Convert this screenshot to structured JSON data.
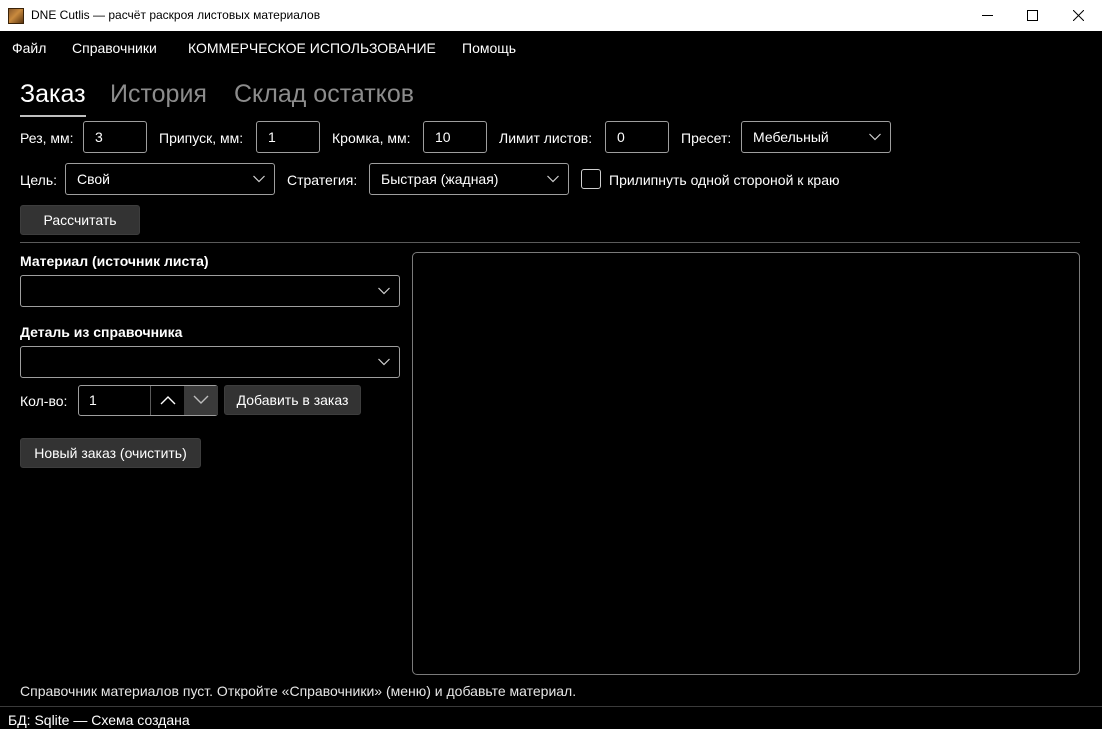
{
  "window": {
    "title": "DNE Cutlis — расчёт раскроя листовых материалов",
    "icon": "app-icon"
  },
  "menu": [
    "Файл",
    "Справочники",
    "КОММЕРЧЕСКОЕ ИСПОЛЬЗОВАНИЕ",
    "Помощь"
  ],
  "tabs": [
    {
      "label": "Заказ",
      "active": true
    },
    {
      "label": "История",
      "active": false
    },
    {
      "label": "Склад остатков",
      "active": false
    }
  ],
  "params": {
    "cut_label": "Рез, мм:",
    "cut_value": "3",
    "allowance_label": "Припуск, мм:",
    "allowance_value": "1",
    "edge_label": "Кромка, мм:",
    "edge_value": "10",
    "sheet_limit_label": "Лимит листов:",
    "sheet_limit_value": "0",
    "preset_label": "Пресет:",
    "preset_value": "Мебельный"
  },
  "goal": {
    "label": "Цель:",
    "value": "Свой"
  },
  "strategy": {
    "label": "Стратегия:",
    "value": "Быстрая (жадная)"
  },
  "stick_edge": {
    "label": "Прилипнуть одной стороной к краю",
    "checked": false
  },
  "calculate_button": "Рассчитать",
  "order": {
    "material_label": "Материал (источник листа)",
    "material_value": "",
    "part_label": "Деталь из справочника",
    "part_value": "",
    "qty_label": "Кол-во:",
    "qty_value": "1",
    "add_button": "Добавить в заказ",
    "new_order_button": "Новый заказ (очистить)"
  },
  "hint": "Справочник материалов пуст. Откройте «Справочники» (меню) и добавьте материал.",
  "status": "БД: Sqlite — Схема создана",
  "colors": {
    "background": "#000000",
    "titlebar": "#ffffff",
    "button": "#333333",
    "border": "#9e9e9e",
    "inactive_tab": "#8c8c8c"
  }
}
